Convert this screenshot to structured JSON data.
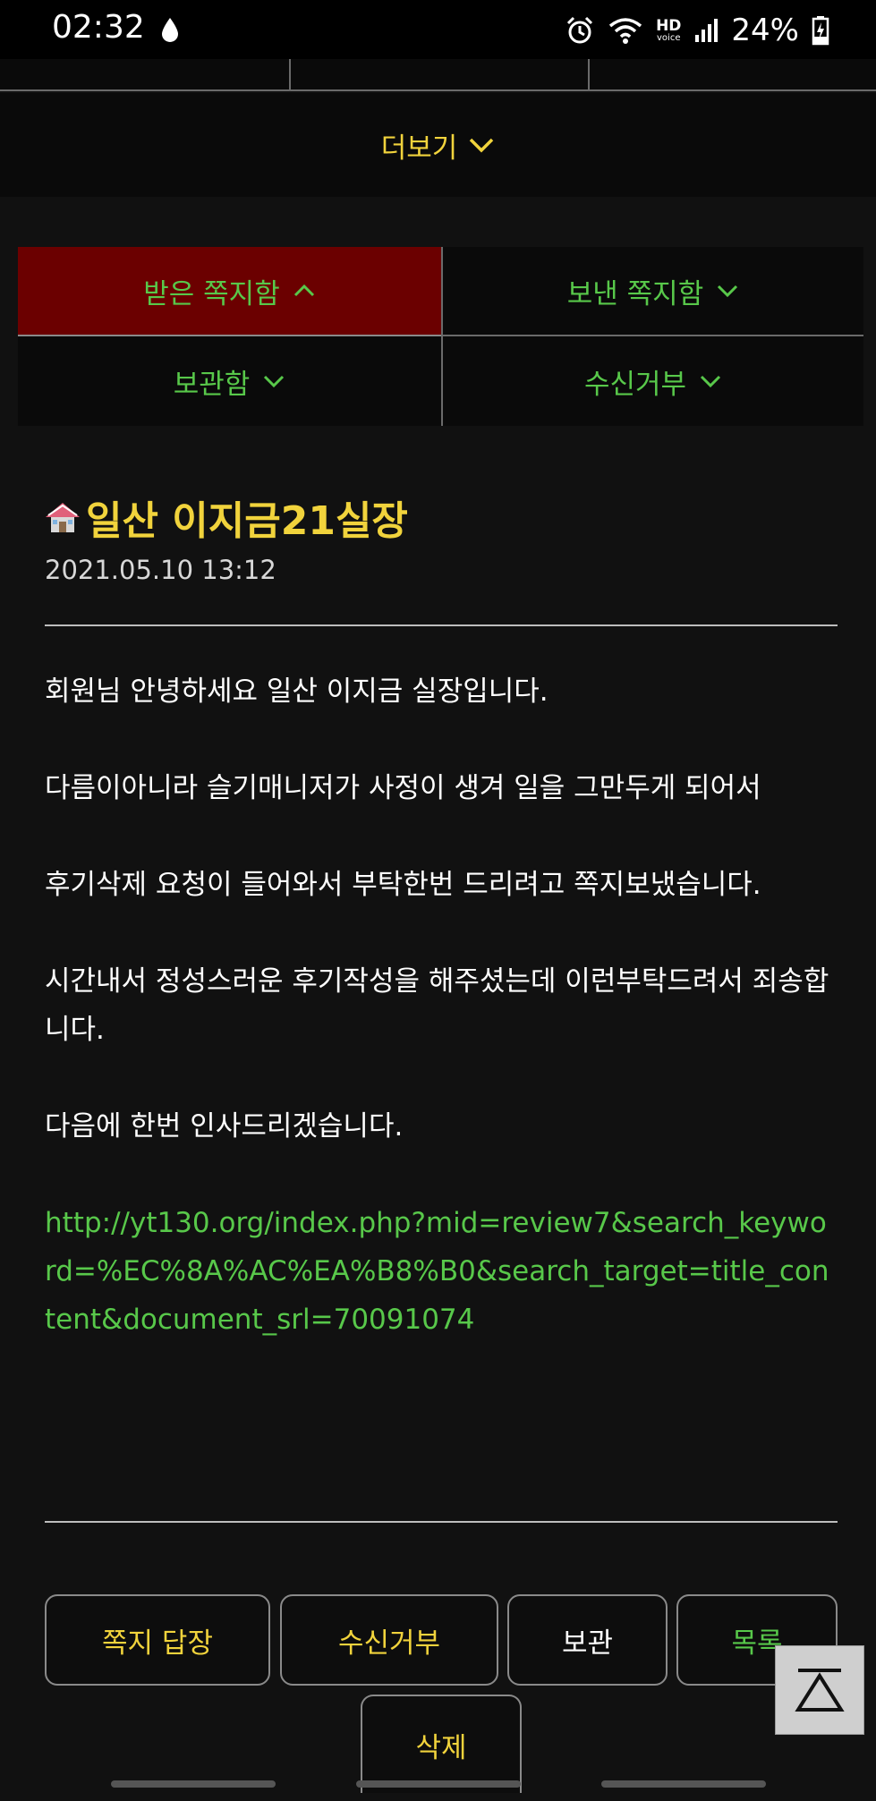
{
  "status": {
    "time": "02:32",
    "hd": "HD",
    "voice": "voice",
    "battery": "24%"
  },
  "more": {
    "label": "더보기"
  },
  "tabs": [
    {
      "label": "받은 쪽지함",
      "chevron": "up"
    },
    {
      "label": "보낸 쪽지함",
      "chevron": "down"
    },
    {
      "label": "보관함",
      "chevron": "down"
    },
    {
      "label": "수신거부",
      "chevron": "down"
    }
  ],
  "message": {
    "title": "일산 이지금21실장",
    "date": "2021.05.10 13:12",
    "paragraphs": [
      "회원님 안녕하세요 일산 이지금 실장입니다.",
      "다름이아니라 슬기매니저가 사정이 생겨 일을 그만두게 되어서",
      "후기삭제 요청이 들어와서 부탁한번 드리려고 쪽지보냈습니다.",
      "시간내서 정성스러운 후기작성을 해주셨는데 이런부탁드려서 죄송합니다.",
      "다음에 한번 인사드리겠습니다."
    ],
    "link": "http://yt130.org/index.php?mid=review7&search_keyword=%EC%8A%AC%EA%B8%B0&search_target=title_content&document_srl=70091074"
  },
  "actions": {
    "reply": "쪽지 답장",
    "block": "수신거부",
    "keep": "보관",
    "list": "목록",
    "delete": "삭제"
  },
  "colors": {
    "accent_yellow": "#f1d33c",
    "accent_green": "#58c84a",
    "active_tab": "#6b0000"
  }
}
